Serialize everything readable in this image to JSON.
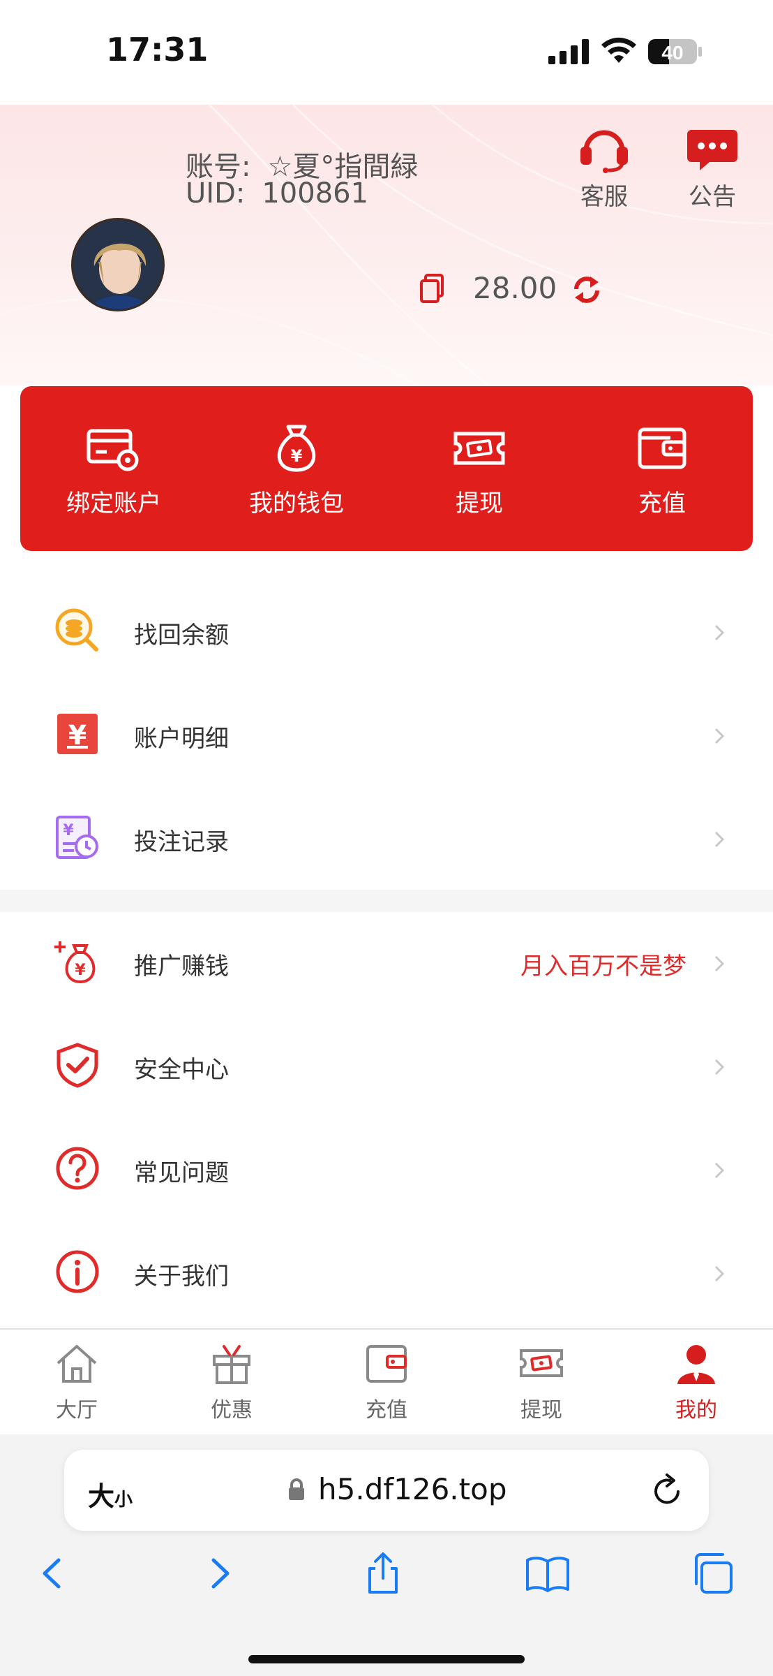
{
  "status_bar": {
    "time": "17:31",
    "battery": "40"
  },
  "header": {
    "service_label": "客服",
    "notice_label": "公告",
    "account_label": "账号:",
    "account_value": "☆夏°指間緑",
    "uid_label": "UID:",
    "uid_value": "100861",
    "balance": "28.00"
  },
  "quick_actions": [
    {
      "label": "绑定账户",
      "icon": "bind-card-icon"
    },
    {
      "label": "我的钱包",
      "icon": "money-bag-icon"
    },
    {
      "label": "提现",
      "icon": "withdraw-ticket-icon"
    },
    {
      "label": "充值",
      "icon": "wallet-icon"
    }
  ],
  "menu": [
    {
      "label": "找回余额",
      "icon": "coin-search-icon"
    },
    {
      "label": "账户明细",
      "icon": "ledger-icon"
    },
    {
      "label": "投注记录",
      "icon": "bet-record-icon"
    },
    {
      "label": "推广赚钱",
      "icon": "promo-bag-icon",
      "extra": "月入百万不是梦"
    },
    {
      "label": "安全中心",
      "icon": "shield-check-icon"
    },
    {
      "label": "常见问题",
      "icon": "question-icon"
    },
    {
      "label": "关于我们",
      "icon": "info-icon"
    }
  ],
  "tabs": [
    {
      "label": "大厅",
      "icon": "home-icon"
    },
    {
      "label": "优惠",
      "icon": "gift-icon"
    },
    {
      "label": "充值",
      "icon": "wallet-icon"
    },
    {
      "label": "提现",
      "icon": "withdraw-ticket-icon"
    },
    {
      "label": "我的",
      "icon": "person-icon",
      "active": true
    }
  ],
  "browser": {
    "text_size_big": "大",
    "text_size_small": "小",
    "url": "h5.df126.top"
  },
  "colors": {
    "brand_red": "#e01e1c",
    "accent_text": "#e02b2b",
    "ios_blue": "#1a7cf5"
  }
}
